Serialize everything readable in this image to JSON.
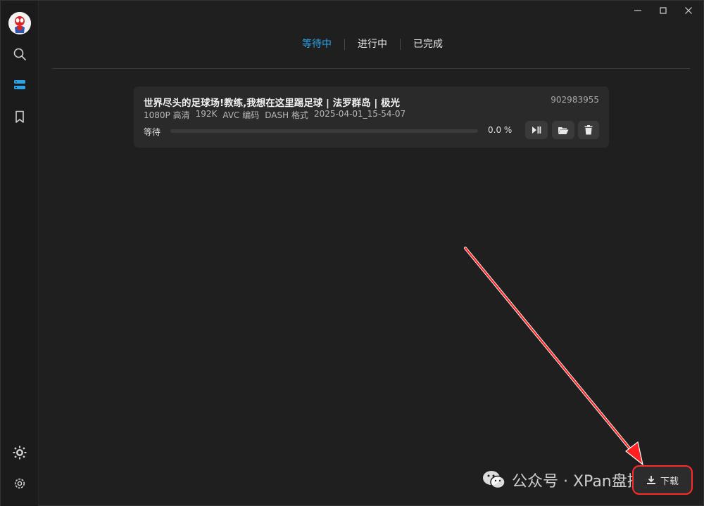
{
  "window_controls": {
    "minimize_icon": "minimize-icon",
    "maximize_icon": "maximize-icon",
    "close_icon": "close-icon"
  },
  "sidebar": {
    "items": [
      {
        "name": "search",
        "icon": "search-icon"
      },
      {
        "name": "downloads",
        "icon": "server-list-icon",
        "active": true
      },
      {
        "name": "bookmarks",
        "icon": "bookmark-icon"
      }
    ],
    "bottom": [
      {
        "name": "theme",
        "icon": "sun-gear-icon"
      },
      {
        "name": "settings",
        "icon": "gear-icon"
      }
    ]
  },
  "tabs": [
    {
      "label": "等待中",
      "active": true
    },
    {
      "label": "进行中",
      "active": false
    },
    {
      "label": "已完成",
      "active": false
    }
  ],
  "task": {
    "title": "世界尽头的足球场!教练,我想在这里踢足球 | 法罗群岛 | 极光",
    "id": "902983955",
    "meta": [
      "1080P 高清",
      "192K",
      "AVC 编码",
      "DASH 格式",
      "2025-04-01_15-54-07"
    ],
    "status": "等待",
    "progress": 0.0,
    "progress_text": "0.0 %"
  },
  "download_button": {
    "label": "下载"
  },
  "watermark": {
    "text": "公众号 · XPan盘搜"
  },
  "colors": {
    "accent": "#2aa3e8",
    "annotation": "#ff2a2a",
    "background": "#1f1f1f",
    "card": "#2a2a2a"
  }
}
